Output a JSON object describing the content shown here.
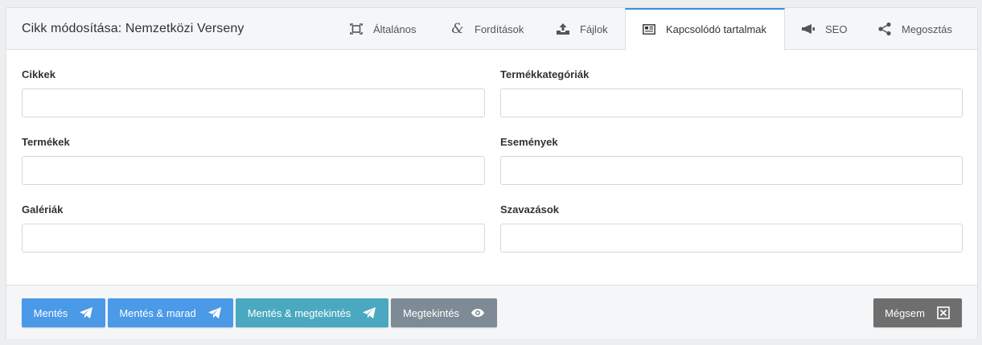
{
  "header": {
    "title": "Cikk módosítása: Nemzetközi Verseny",
    "tabs": [
      {
        "label": "Általános",
        "icon": "expand-icon"
      },
      {
        "label": "Fordítások",
        "icon": "ampersand-icon"
      },
      {
        "label": "Fájlok",
        "icon": "upload-icon"
      },
      {
        "label": "Kapcsolódó tartalmak",
        "icon": "newspaper-icon",
        "active": true
      },
      {
        "label": "SEO",
        "icon": "megaphone-icon"
      },
      {
        "label": "Megosztás",
        "icon": "share-icon"
      }
    ]
  },
  "fields": {
    "cikkek": {
      "label": "Cikkek",
      "value": ""
    },
    "termekkategoriak": {
      "label": "Termékkategóriák",
      "value": ""
    },
    "termekek": {
      "label": "Termékek",
      "value": ""
    },
    "esemenyek": {
      "label": "Események",
      "value": ""
    },
    "galeriak": {
      "label": "Galériák",
      "value": ""
    },
    "szavazasok": {
      "label": "Szavazások",
      "value": ""
    }
  },
  "footer": {
    "save": "Mentés",
    "save_stay": "Mentés & marad",
    "save_preview": "Mentés & megtekintés",
    "preview": "Megtekintés",
    "cancel": "Mégsem"
  },
  "colors": {
    "primary": "#4a9ae8",
    "info": "#4aa9c0",
    "secondary": "#7e8b96",
    "cancel": "#6e6e6e",
    "active_tab_accent": "#3a8fdd"
  }
}
